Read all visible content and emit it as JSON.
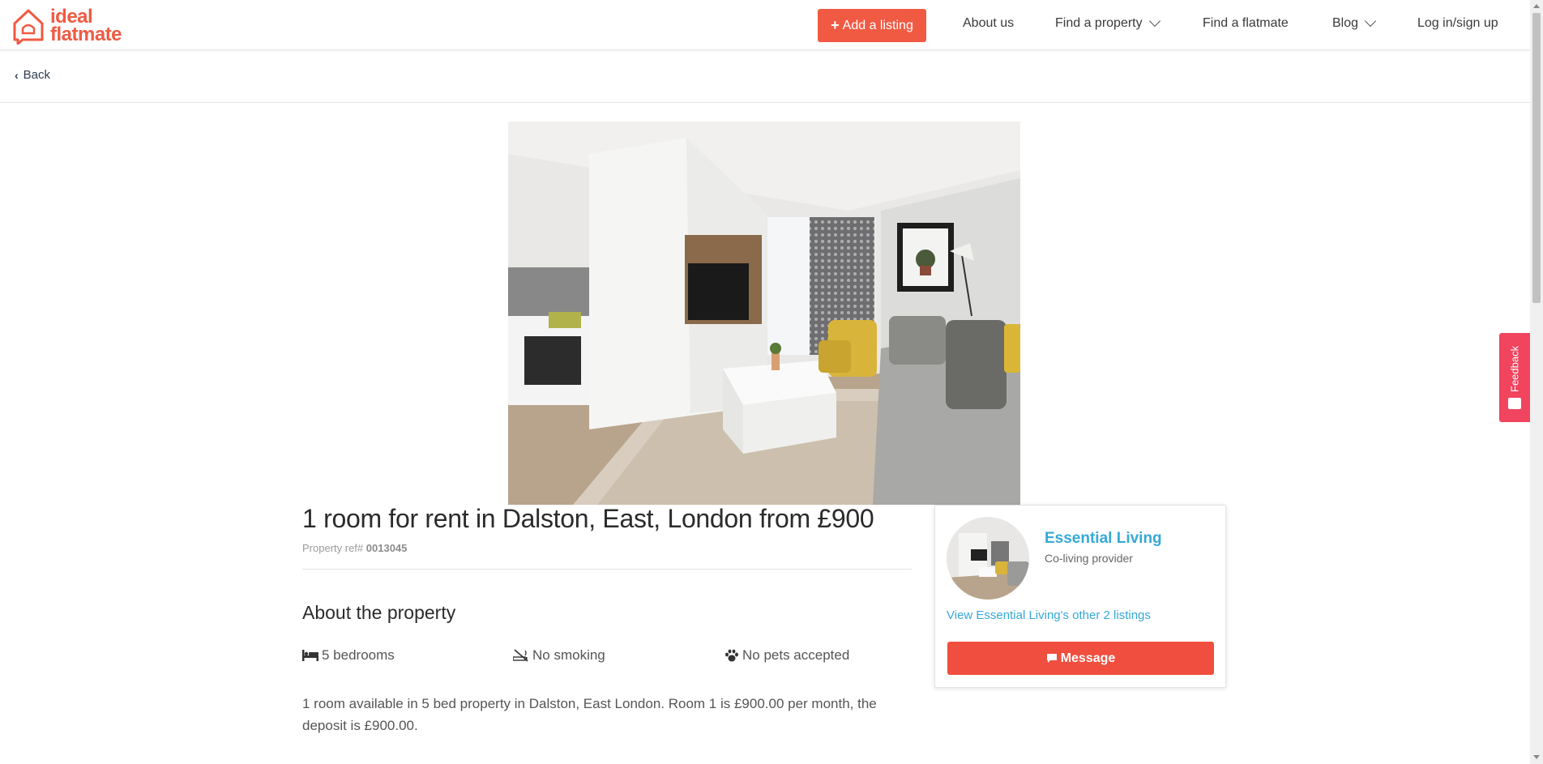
{
  "brand": {
    "logo_line1": "ideal",
    "logo_line2": "flatmate",
    "accent_color": "#f05a43"
  },
  "nav": {
    "add_listing": "Add a listing",
    "about_us": "About us",
    "find_property": "Find a property",
    "find_flatmate": "Find a flatmate",
    "blog": "Blog",
    "login": "Log in/sign up"
  },
  "subnav": {
    "back": "Back"
  },
  "feedback": {
    "label": "Feedback"
  },
  "listing": {
    "title": "1 room for rent in Dalston, East, London from £900",
    "ref_label": "Property ref#",
    "ref_number": "0013045",
    "about_heading": "About the property",
    "features": [
      {
        "icon": "bed-icon",
        "label": "5 bedrooms"
      },
      {
        "icon": "no-smoking-icon",
        "label": "No smoking"
      },
      {
        "icon": "paw-icon",
        "label": "No pets accepted"
      }
    ],
    "description": "1 room available in 5 bed property in Dalston, East London. Room 1 is £900.00 per month, the deposit is £900.00."
  },
  "agent": {
    "name": "Essential Living",
    "type": "Co-living provider",
    "other_listings": "View Essential Living's other 2 listings",
    "message_button": "Message",
    "link_color": "#35a9d8"
  }
}
